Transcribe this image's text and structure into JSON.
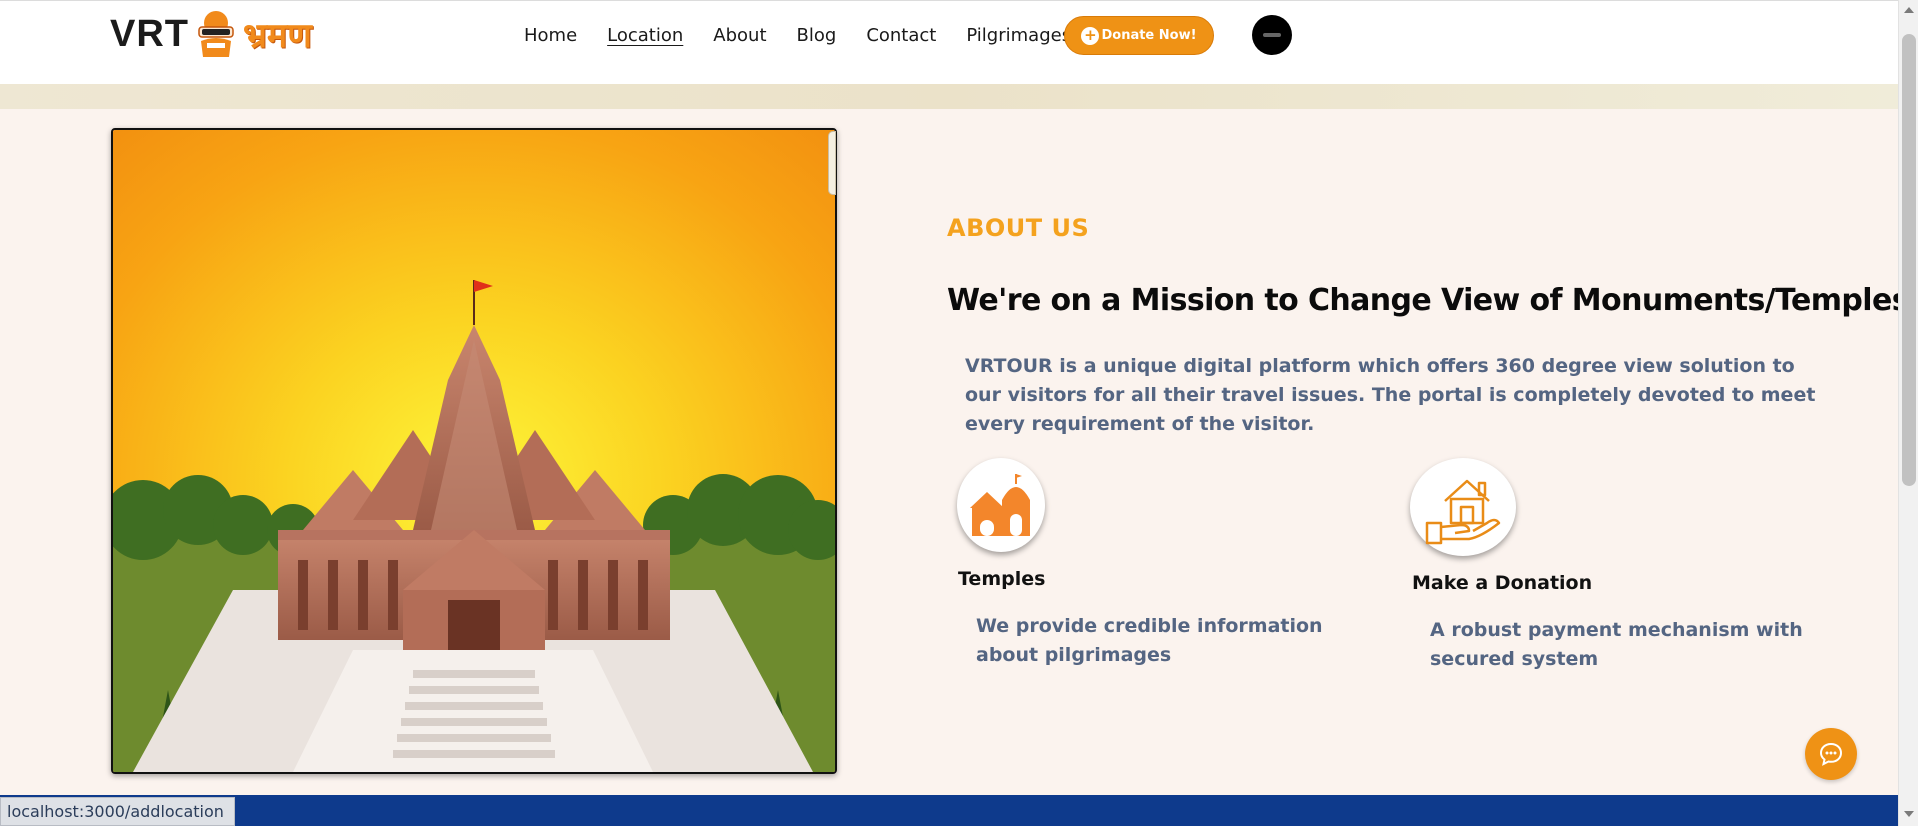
{
  "header": {
    "logo": {
      "text_left": "VRT",
      "text_hindi": "भ्रमण"
    },
    "nav": [
      {
        "label": "Home",
        "active": false
      },
      {
        "label": "Location",
        "active": true
      },
      {
        "label": "About",
        "active": false
      },
      {
        "label": "Blog",
        "active": false
      },
      {
        "label": "Contact",
        "active": false
      },
      {
        "label": "Pilgrimages",
        "active": false
      }
    ],
    "donate_button": "Donate Now!",
    "donate_icon": "plus-circle-icon",
    "profile_icon": "avatar"
  },
  "main": {
    "image_alt_icon": "temple-image",
    "about_tag": "ABOUT US",
    "heading": "We're on a Mission to Change View of Monuments/Temples.",
    "description": "VRTOUR is a unique digital platform which offers 360 degree view solution to our visitors for all their travel issues. The portal is completely devoted to meet every requirement of the visitor.",
    "features": [
      {
        "icon": "temple-icon",
        "title": "Temples",
        "description": "We provide credible information about pilgrimages"
      },
      {
        "icon": "hand-house-icon",
        "title": "Make a Donation",
        "description": "A robust payment mechanism with secured system"
      }
    ]
  },
  "chat_button_icon": "chat-bubble-icon",
  "status_bar": {
    "url": "localhost:3000/addlocation"
  },
  "colors": {
    "accent": "#ef9215",
    "heading_orange": "#f4a21e",
    "footer": "#0e3a8c",
    "body_text": "#546582",
    "background": "#fbf3ee"
  }
}
